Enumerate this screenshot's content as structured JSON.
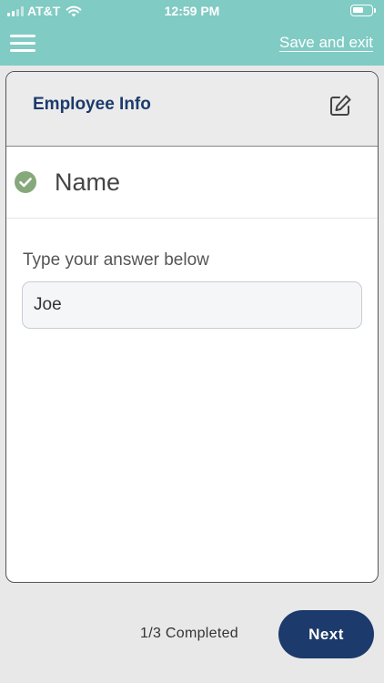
{
  "status_bar": {
    "carrier": "AT&T",
    "time": "12:59 PM",
    "signal_icon": "signal-bars-icon",
    "wifi_icon": "wifi-icon",
    "battery_icon": "battery-icon"
  },
  "header": {
    "menu_icon": "hamburger-menu-icon",
    "save_exit_label": "Save and exit",
    "color": "#80cbc4"
  },
  "card": {
    "title": "Employee Info",
    "edit_icon": "edit-icon",
    "question": {
      "status_icon": "check-circle-icon",
      "status_color": "#86a97c",
      "label": "Name"
    },
    "prompt": "Type your answer below",
    "answer_value": "Joe"
  },
  "footer": {
    "progress_text": "1/3 Completed",
    "next_label": "Next",
    "next_color": "#1c3a6b"
  }
}
